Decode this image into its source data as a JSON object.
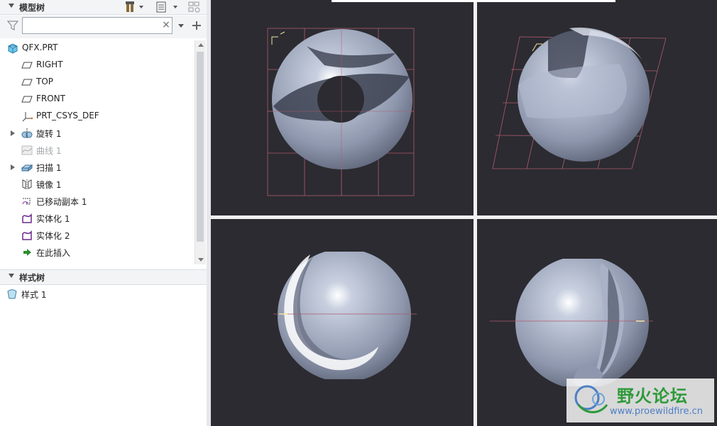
{
  "model_tree": {
    "title": "模型树",
    "filter_placeholder": "",
    "clear_symbol": "×",
    "items": [
      {
        "label": "QFX.PRT",
        "icon": "part-icon"
      },
      {
        "label": "RIGHT",
        "icon": "datum-plane-icon"
      },
      {
        "label": "TOP",
        "icon": "datum-plane-icon"
      },
      {
        "label": "FRONT",
        "icon": "datum-plane-icon"
      },
      {
        "label": "PRT_CSYS_DEF",
        "icon": "coordinate-system-icon"
      },
      {
        "label": "旋转 1",
        "icon": "revolve-icon"
      },
      {
        "label": "曲线 1",
        "icon": "curve-icon"
      },
      {
        "label": "扫描 1",
        "icon": "sweep-icon"
      },
      {
        "label": "镜像 1",
        "icon": "mirror-icon"
      },
      {
        "label": "已移动副本 1",
        "icon": "moved-copy-icon"
      },
      {
        "label": "实体化 1",
        "icon": "solidify-icon"
      },
      {
        "label": "实体化 2",
        "icon": "solidify-icon"
      },
      {
        "label": "在此插入",
        "icon": "insert-here-icon"
      }
    ]
  },
  "style_tree": {
    "title": "样式树",
    "items": [
      {
        "label": "样式 1",
        "icon": "style-icon"
      }
    ]
  },
  "watermark": {
    "title": "野火论坛",
    "url": "www.proewildfire.cn"
  },
  "colors": {
    "viewport_bg": "#2b2b31",
    "model_surface": "#9aa3b8",
    "datum_grid": "#b05a6a",
    "panel_bg": "#ffffff",
    "accent": "#2f9a3a"
  }
}
